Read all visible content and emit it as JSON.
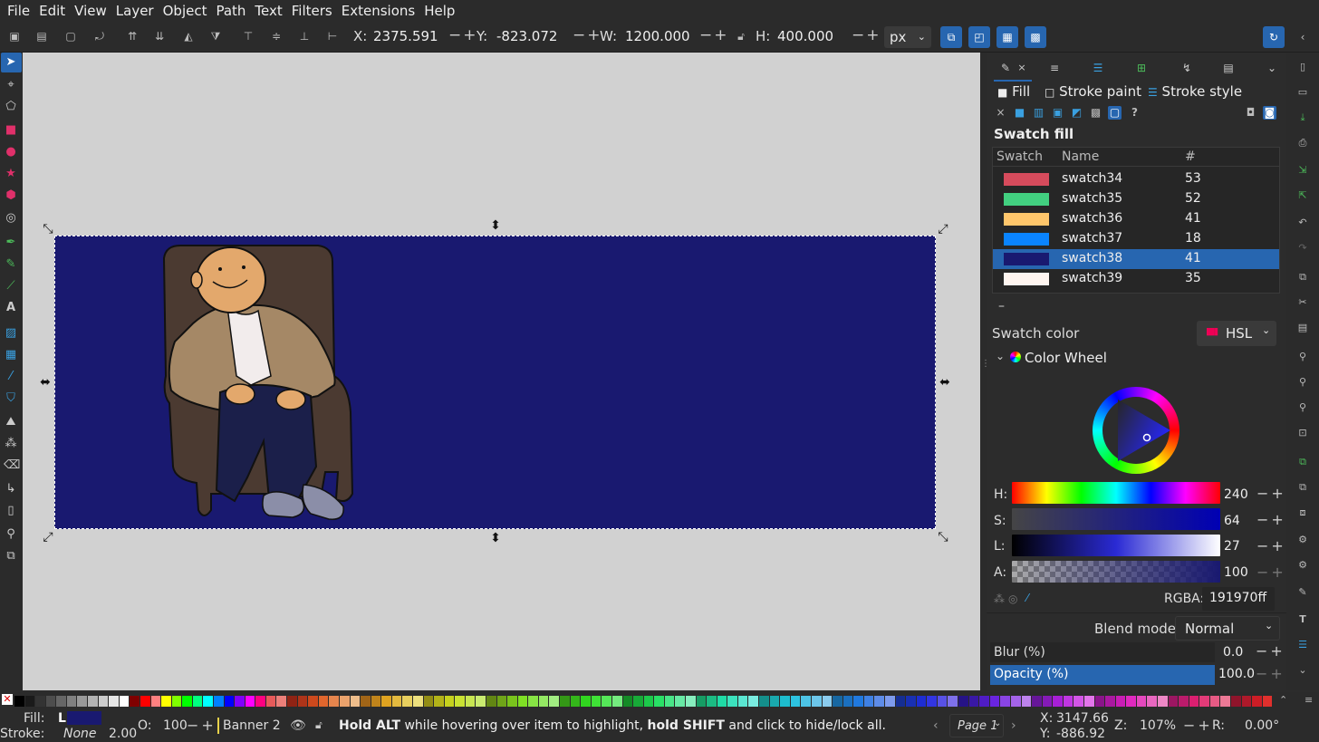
{
  "menu": [
    "File",
    "Edit",
    "View",
    "Layer",
    "Object",
    "Path",
    "Text",
    "Filters",
    "Extensions",
    "Help"
  ],
  "toolbar": {
    "x_label": "X:",
    "x_value": "2375.591",
    "y_label": "Y:",
    "y_value": "-823.072",
    "w_label": "W:",
    "w_value": "1200.000",
    "h_label": "H:",
    "h_value": "400.000",
    "unit": "px"
  },
  "panel": {
    "subtabs": {
      "fill": "Fill",
      "stroke_paint": "Stroke paint",
      "stroke_style": "Stroke style"
    },
    "swatch_fill_title": "Swatch fill",
    "columns": {
      "swatch": "Swatch",
      "name": "Name",
      "count": "#"
    },
    "swatches": [
      {
        "name": "swatch34",
        "count": "53",
        "color": "#d64b5c"
      },
      {
        "name": "swatch35",
        "count": "52",
        "color": "#42d080"
      },
      {
        "name": "swatch36",
        "count": "41",
        "color": "#ffc66b"
      },
      {
        "name": "swatch37",
        "count": "18",
        "color": "#0a84ff"
      },
      {
        "name": "swatch38",
        "count": "41",
        "color": "#191970"
      },
      {
        "name": "swatch39",
        "count": "35",
        "color": "#fff5f0"
      }
    ],
    "minus_label": "–",
    "swatch_color_label": "Swatch color",
    "color_mode": "HSL",
    "color_wheel_label": "Color Wheel",
    "sliders": {
      "h": {
        "label": "H:",
        "value": "240"
      },
      "s": {
        "label": "S:",
        "value": "64"
      },
      "l": {
        "label": "L:",
        "value": "27"
      },
      "a": {
        "label": "A:",
        "value": "100"
      }
    },
    "rgba_label": "RGBA:",
    "rgba_value": "191970ff",
    "blend_label": "Blend mode:",
    "blend_value": "Normal",
    "blur_label": "Blur (%)",
    "blur_value": "0.0",
    "opacity_label": "Opacity (%)",
    "opacity_value": "100.0"
  },
  "status": {
    "fill_label": "Fill:",
    "fill_value": "L",
    "stroke_label": "Stroke:",
    "stroke_value": "None",
    "stroke_width": "2.00",
    "opacity_label": "O:",
    "opacity_value": "100",
    "layer_name": "Banner 2",
    "message_bold1": "Hold ALT",
    "message_mid": " while hovering over item to highlight, ",
    "message_bold2": "hold SHIFT",
    "message_end": " and click to hide/lock all.",
    "page": "Page 1",
    "cursor_x_label": "X:",
    "cursor_x": "3147.66",
    "cursor_y_label": "Y:",
    "cursor_y": "-886.92",
    "zoom_label": "Z:",
    "zoom": "107%",
    "rotate_label": "R:",
    "rotate": "0.00°"
  },
  "accent": "#2766b0",
  "fill_color": "#191970"
}
